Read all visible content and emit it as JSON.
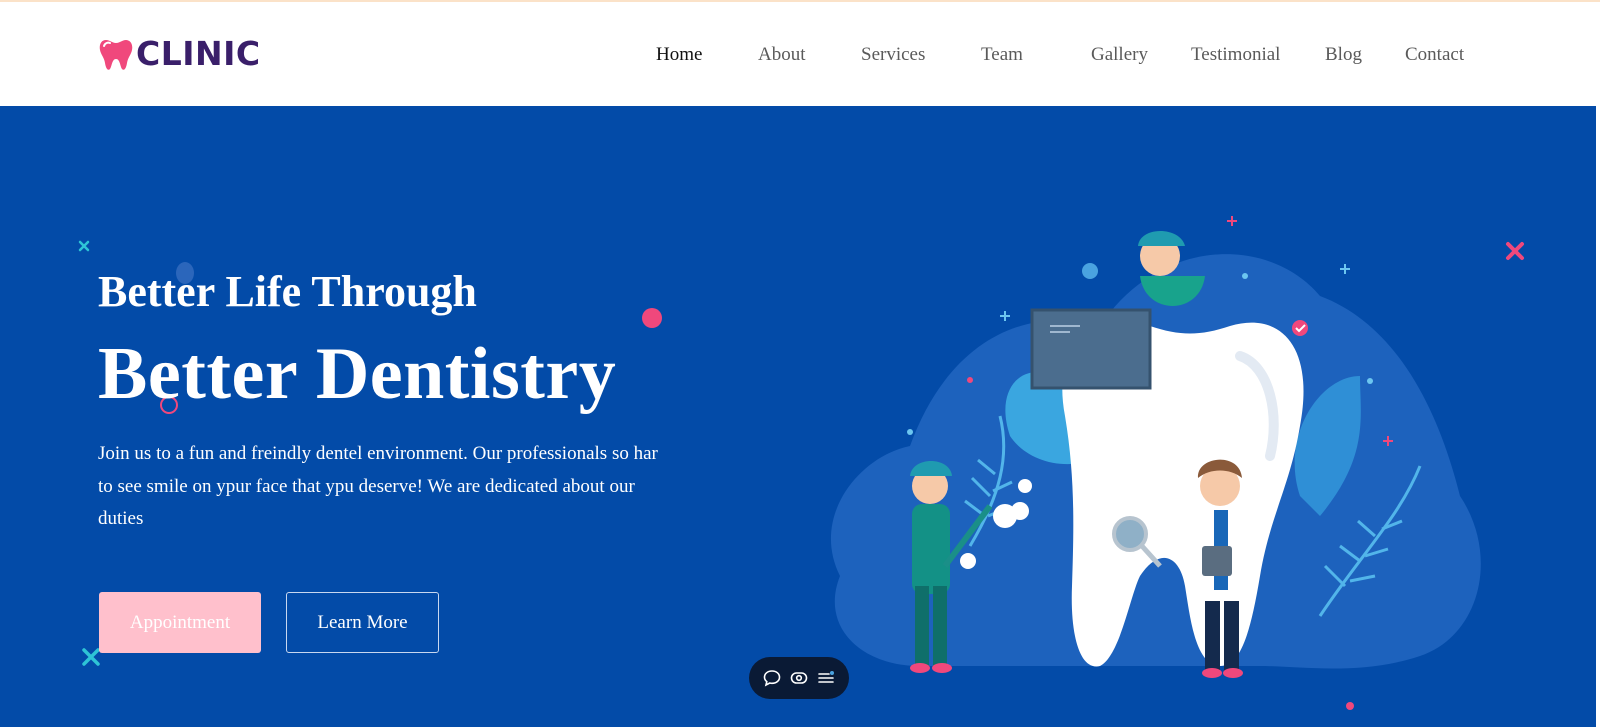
{
  "brand": {
    "name": "CLINIC",
    "icon": "tooth-icon",
    "color": "#3a1f6a",
    "icon_color": "#f0487c"
  },
  "nav": {
    "items": [
      {
        "label": "Home",
        "active": true
      },
      {
        "label": "About",
        "active": false
      },
      {
        "label": "Services",
        "active": false
      },
      {
        "label": "Team",
        "active": false
      },
      {
        "label": "Gallery",
        "active": false
      },
      {
        "label": "Testimonial",
        "active": false
      },
      {
        "label": "Blog",
        "active": false
      },
      {
        "label": "Contact",
        "active": false
      }
    ]
  },
  "hero": {
    "subtitle": "Better Life Through",
    "title": "Better Dentistry",
    "description": "Join us to a fun and freindly dentel environment. Our professionals so har to see smile on ypur face that ypu deserve! We are dedicated about our duties",
    "primary_button": "Appointment",
    "secondary_button": "Learn More",
    "background_color": "#034ba8",
    "accent_color": "#f0487c",
    "illustration": "dentists-tooth-illustration"
  },
  "toolbar": {
    "icons": [
      "chat-icon",
      "eye-icon",
      "list-icon"
    ]
  }
}
